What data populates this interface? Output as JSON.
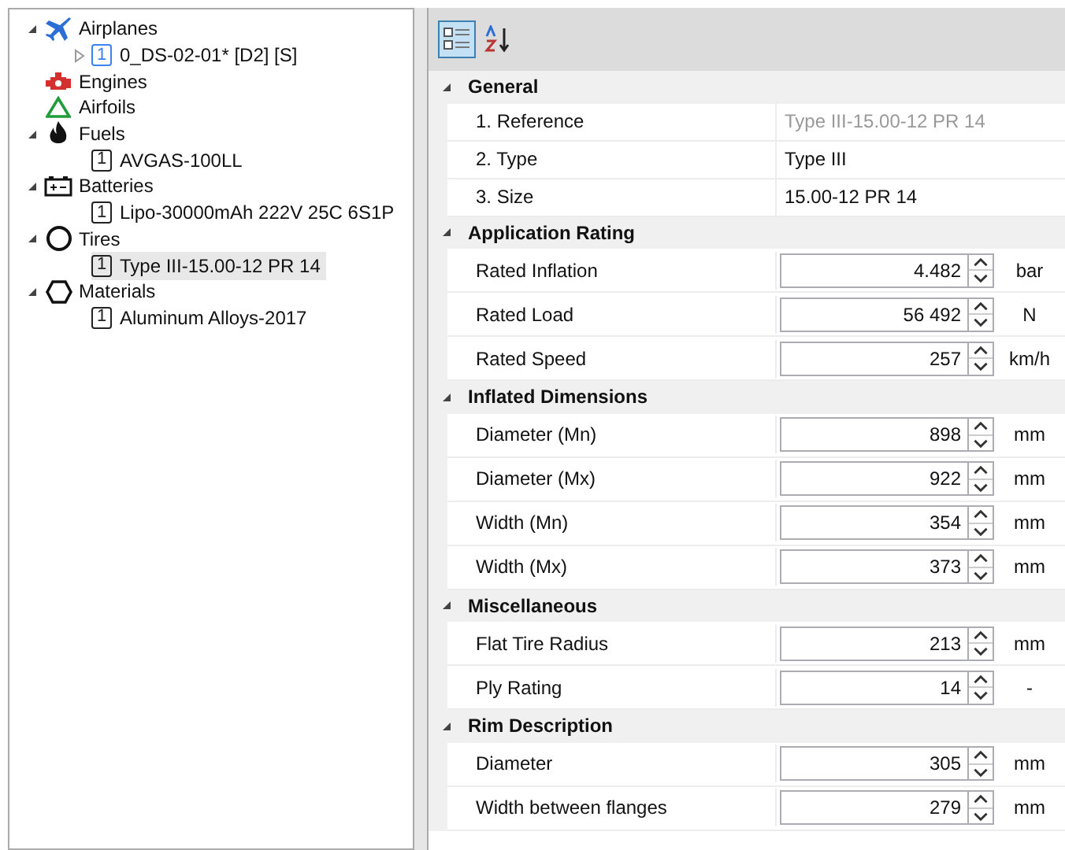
{
  "tree": [
    {
      "label": "Airplanes",
      "kind": "airplane",
      "expanded": true,
      "children": [
        {
          "badge": "1",
          "label": "0_DS-02-01* [D2] [S]",
          "expanded": false,
          "selected": false,
          "color": "#3b82f6"
        }
      ]
    },
    {
      "label": "Engines",
      "kind": "engine"
    },
    {
      "label": "Airfoils",
      "kind": "airfoil"
    },
    {
      "label": "Fuels",
      "kind": "fuel",
      "expanded": true,
      "children": [
        {
          "badge": "1",
          "label": "AVGAS-100LL",
          "selected": false,
          "color": "#222222"
        }
      ]
    },
    {
      "label": "Batteries",
      "kind": "battery",
      "expanded": true,
      "children": [
        {
          "badge": "1",
          "label": "Lipo-30000mAh 222V 25C 6S1P",
          "selected": false,
          "color": "#222222"
        }
      ]
    },
    {
      "label": "Tires",
      "kind": "tire",
      "expanded": true,
      "children": [
        {
          "badge": "1",
          "label": "Type III-15.00-12 PR 14",
          "selected": true,
          "color": "#222222"
        }
      ]
    },
    {
      "label": "Materials",
      "kind": "material",
      "expanded": true,
      "children": [
        {
          "badge": "1",
          "label": "Aluminum Alloys-2017",
          "selected": false,
          "color": "#222222"
        }
      ]
    }
  ],
  "toolbar": [
    {
      "kind": "categorized",
      "selected": true
    },
    {
      "kind": "alphabetical",
      "selected": false
    }
  ],
  "sections": [
    {
      "title": "General",
      "expanded": true,
      "rows": [
        {
          "kind": "text",
          "label": "1. Reference",
          "value": "Type III-15.00-12 PR 14",
          "disabled": true
        },
        {
          "kind": "text",
          "label": "2. Type",
          "value": "Type III",
          "disabled": false
        },
        {
          "kind": "text",
          "label": "3. Size",
          "value": "15.00-12 PR 14",
          "disabled": false
        }
      ]
    },
    {
      "title": "Application Rating",
      "expanded": true,
      "rows": [
        {
          "kind": "spinner",
          "label": "Rated Inflation",
          "value": "4.482",
          "unit": "bar"
        },
        {
          "kind": "spinner",
          "label": "Rated Load",
          "value": "56 492",
          "unit": "N"
        },
        {
          "kind": "spinner",
          "label": "Rated Speed",
          "value": "257",
          "unit": "km/h"
        }
      ]
    },
    {
      "title": "Inflated Dimensions",
      "expanded": true,
      "rows": [
        {
          "kind": "spinner",
          "label": "Diameter (Mn)",
          "value": "898",
          "unit": "mm"
        },
        {
          "kind": "spinner",
          "label": "Diameter (Mx)",
          "value": "922",
          "unit": "mm"
        },
        {
          "kind": "spinner",
          "label": "Width (Mn)",
          "value": "354",
          "unit": "mm"
        },
        {
          "kind": "spinner",
          "label": "Width (Mx)",
          "value": "373",
          "unit": "mm"
        }
      ]
    },
    {
      "title": "Miscellaneous",
      "expanded": true,
      "rows": [
        {
          "kind": "spinner",
          "label": "Flat Tire Radius",
          "value": "213",
          "unit": "mm"
        },
        {
          "kind": "spinner",
          "label": "Ply Rating",
          "value": "14",
          "unit": "-"
        }
      ]
    },
    {
      "title": "Rim Description",
      "expanded": true,
      "rows": [
        {
          "kind": "spinner",
          "label": "Diameter",
          "value": "305",
          "unit": "mm"
        },
        {
          "kind": "spinner",
          "label": "Width between flanges",
          "value": "279",
          "unit": "mm"
        }
      ]
    }
  ]
}
